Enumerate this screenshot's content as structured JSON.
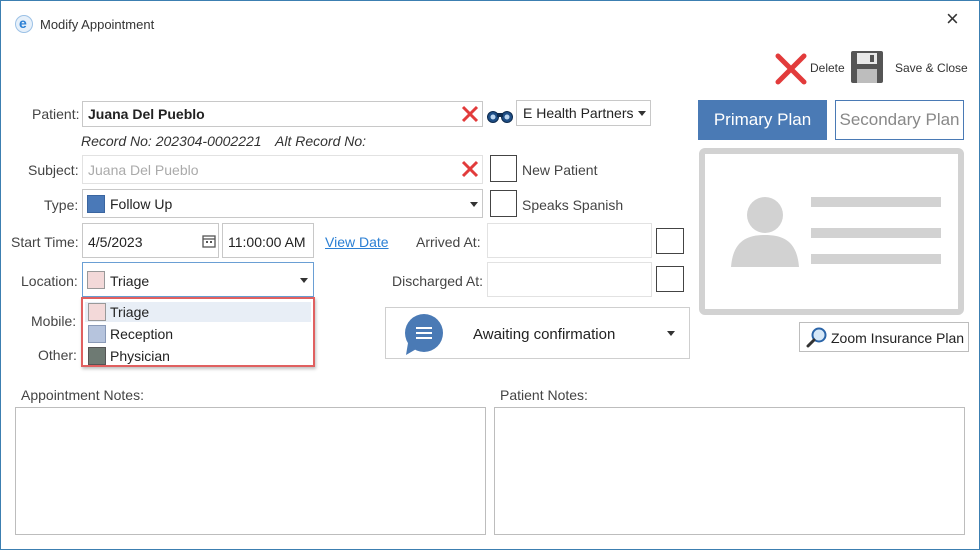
{
  "window": {
    "title": "Modify Appointment",
    "close_glyph": "×",
    "app_icon": "e-logo-icon"
  },
  "toolbar": {
    "delete_label": "Delete",
    "save_close_label": "Save & Close"
  },
  "patient": {
    "label": "Patient:",
    "value": "Juana Del Pueblo",
    "record_no": "Record No: 202304-0002221",
    "alt_record": "Alt Record No:",
    "provider": "E Health Partners"
  },
  "subject": {
    "label": "Subject:",
    "placeholder": "Juana Del Pueblo"
  },
  "type": {
    "label": "Type:",
    "value": "Follow Up",
    "color": "#4a79b8"
  },
  "start": {
    "label": "Start Time:",
    "date": "4/5/2023",
    "time": "11:00:00 AM",
    "view_date": "View Date"
  },
  "location": {
    "label": "Location:",
    "value": "Triage",
    "options": [
      {
        "label": "Triage",
        "color": "#f3d9d9"
      },
      {
        "label": "Reception",
        "color": "#b6c4dd"
      },
      {
        "label": "Physician",
        "color": "#6e7a73"
      }
    ]
  },
  "mobile": {
    "label": "Mobile:"
  },
  "other": {
    "label": "Other:"
  },
  "checks": {
    "new_patient": "New Patient",
    "speaks_spanish": "Speaks Spanish"
  },
  "arrived": {
    "label": "Arrived At:"
  },
  "discharged": {
    "label": "Discharged At:"
  },
  "status": {
    "value": "Awaiting confirmation"
  },
  "plans": {
    "primary": "Primary Plan",
    "secondary": "Secondary Plan",
    "zoom": "Zoom Insurance Plan"
  },
  "notes": {
    "appointment": "Appointment Notes:",
    "patient": "Patient Notes:"
  },
  "colors": {
    "accent": "#4a7ab5",
    "danger": "#e23b3b",
    "link": "#2a7fd4",
    "dropdown_border": "#e06060"
  }
}
